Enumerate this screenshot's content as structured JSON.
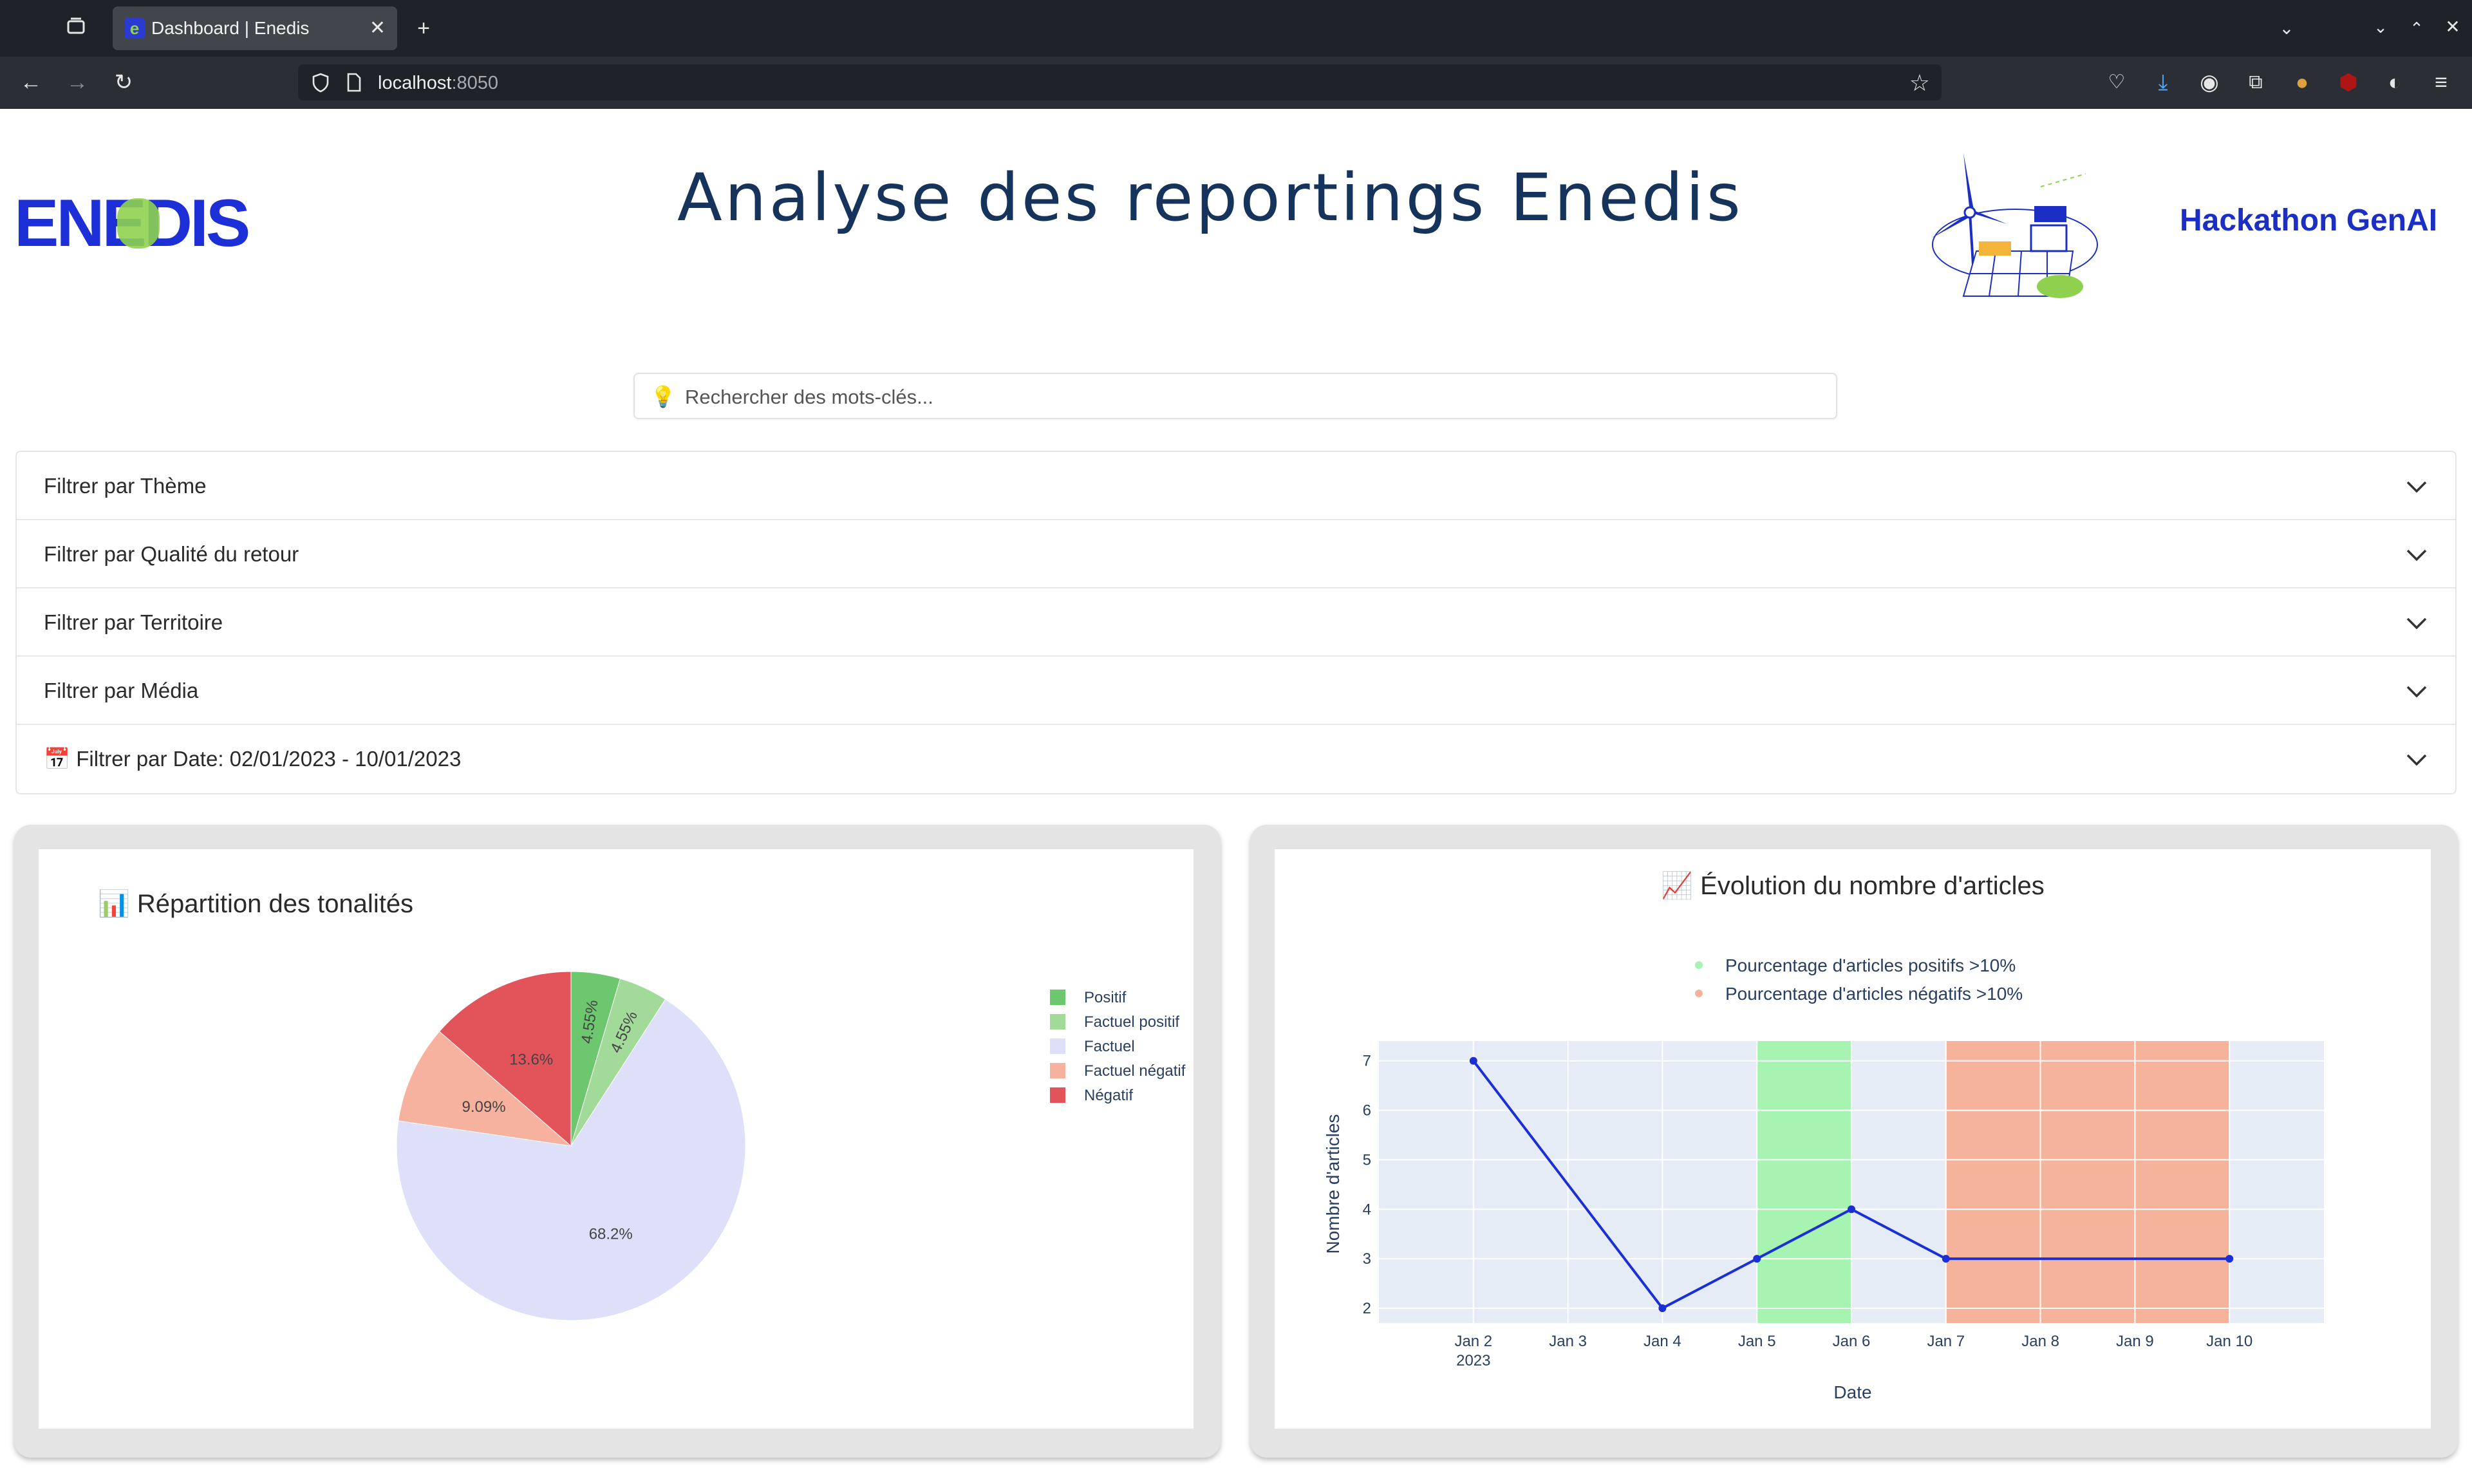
{
  "browser": {
    "tab_title": "Dashboard | Enedis",
    "url_host": "localhost",
    "url_port": ":8050"
  },
  "header": {
    "logo_text": "ENEDIS",
    "title": "Analyse des reportings Enedis",
    "hackathon": "Hackathon GenAI"
  },
  "search": {
    "icon": "💡",
    "placeholder": "Rechercher des mots-clés..."
  },
  "filters": [
    {
      "label": "Filtrer par Thème"
    },
    {
      "label": "Filtrer par Qualité du retour"
    },
    {
      "label": "Filtrer par Territoire"
    },
    {
      "label": "Filtrer par Média"
    },
    {
      "label": "📅 Filtrer par Date: 02/01/2023 - 10/01/2023"
    }
  ],
  "pie_chart": {
    "title": "📊 Répartition des tonalités",
    "chart_data": {
      "type": "pie",
      "slices": [
        {
          "label": "Positif",
          "value": 4.55,
          "text": "4.55%",
          "color": "#6cc76f"
        },
        {
          "label": "Factuel positif",
          "value": 4.55,
          "text": "4.55%",
          "color": "#a2db99"
        },
        {
          "label": "Factuel",
          "value": 68.2,
          "text": "68.2%",
          "color": "#dedff9"
        },
        {
          "label": "Factuel négatif",
          "value": 9.09,
          "text": "9.09%",
          "color": "#f6b29e"
        },
        {
          "label": "Négatif",
          "value": 13.6,
          "text": "13.6%",
          "color": "#e2535a"
        }
      ],
      "legend": "right"
    }
  },
  "line_chart": {
    "title": "📈 Évolution du nombre d'articles",
    "legend": [
      {
        "label": "Pourcentage d'articles positifs >10%",
        "color": "#a7f3b1"
      },
      {
        "label": "Pourcentage d'articles négatifs >10%",
        "color": "#f5b39c"
      }
    ],
    "chart_data": {
      "type": "line",
      "xlabel": "Date",
      "ylabel": "Nombre d'articles",
      "x_ticks": [
        "Jan 2",
        "Jan 3",
        "Jan 4",
        "Jan 5",
        "Jan 6",
        "Jan 7",
        "Jan 8",
        "Jan 9",
        "Jan 10"
      ],
      "x_year": "2023",
      "y_ticks": [
        2,
        3,
        4,
        5,
        6,
        7
      ],
      "x_range": [
        "2023-01-01",
        "2023-01-11"
      ],
      "y_range": [
        1.7,
        7.4
      ],
      "series": [
        {
          "x": [
            "2023-01-02",
            "2023-01-04",
            "2023-01-05",
            "2023-01-06",
            "2023-01-07",
            "2023-01-10"
          ],
          "values": [
            7,
            2,
            3,
            4,
            3,
            3
          ],
          "color": "#1b2fd6"
        }
      ],
      "positive_band": [
        "2023-01-05",
        "2023-01-06"
      ],
      "negative_band": [
        "2023-01-07",
        "2023-01-10"
      ],
      "plot_bg": "#e5ecf6",
      "grid": true
    }
  }
}
